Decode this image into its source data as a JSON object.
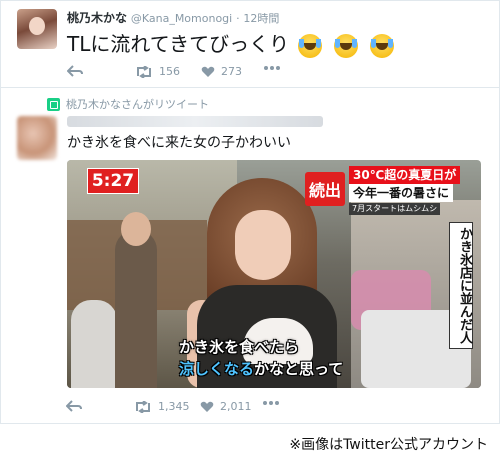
{
  "tweet1": {
    "display_name": "桃乃木かな",
    "handle": "@Kana_Momonogi",
    "separator": "·",
    "timestamp": "12時間",
    "text": "TLに流れてきてびっくり",
    "emoji": [
      "face-with-tears-of-joy",
      "face-with-tears-of-joy",
      "face-with-tears-of-joy"
    ],
    "actions": {
      "retweet_count": "156",
      "like_count": "273"
    }
  },
  "tweet2": {
    "retweet_notice": "桃乃木かなさんがリツイート",
    "text": "かき氷を食べに来た女の子かわいい",
    "media": {
      "time_badge": "5:27",
      "headline_tag": "続出",
      "headline_line1": "30℃超の真夏日が",
      "headline_line2": "今年一番の暑さに",
      "headline_sub": "7月スタートはムシムシ",
      "vertical_caption": "かき氷店に並んだ人",
      "subtitle_line1": "かき氷を食べたら",
      "subtitle_line2_highlight": "涼しくなる",
      "subtitle_line2_rest": "かなと思って"
    },
    "actions": {
      "retweet_count": "1,345",
      "like_count": "2,011"
    }
  },
  "source_note": "※画像はTwitter公式アカウント",
  "colors": {
    "accent_red": "#e02020",
    "retweet_green": "#19cf86",
    "muted_text": "#8899a6"
  }
}
